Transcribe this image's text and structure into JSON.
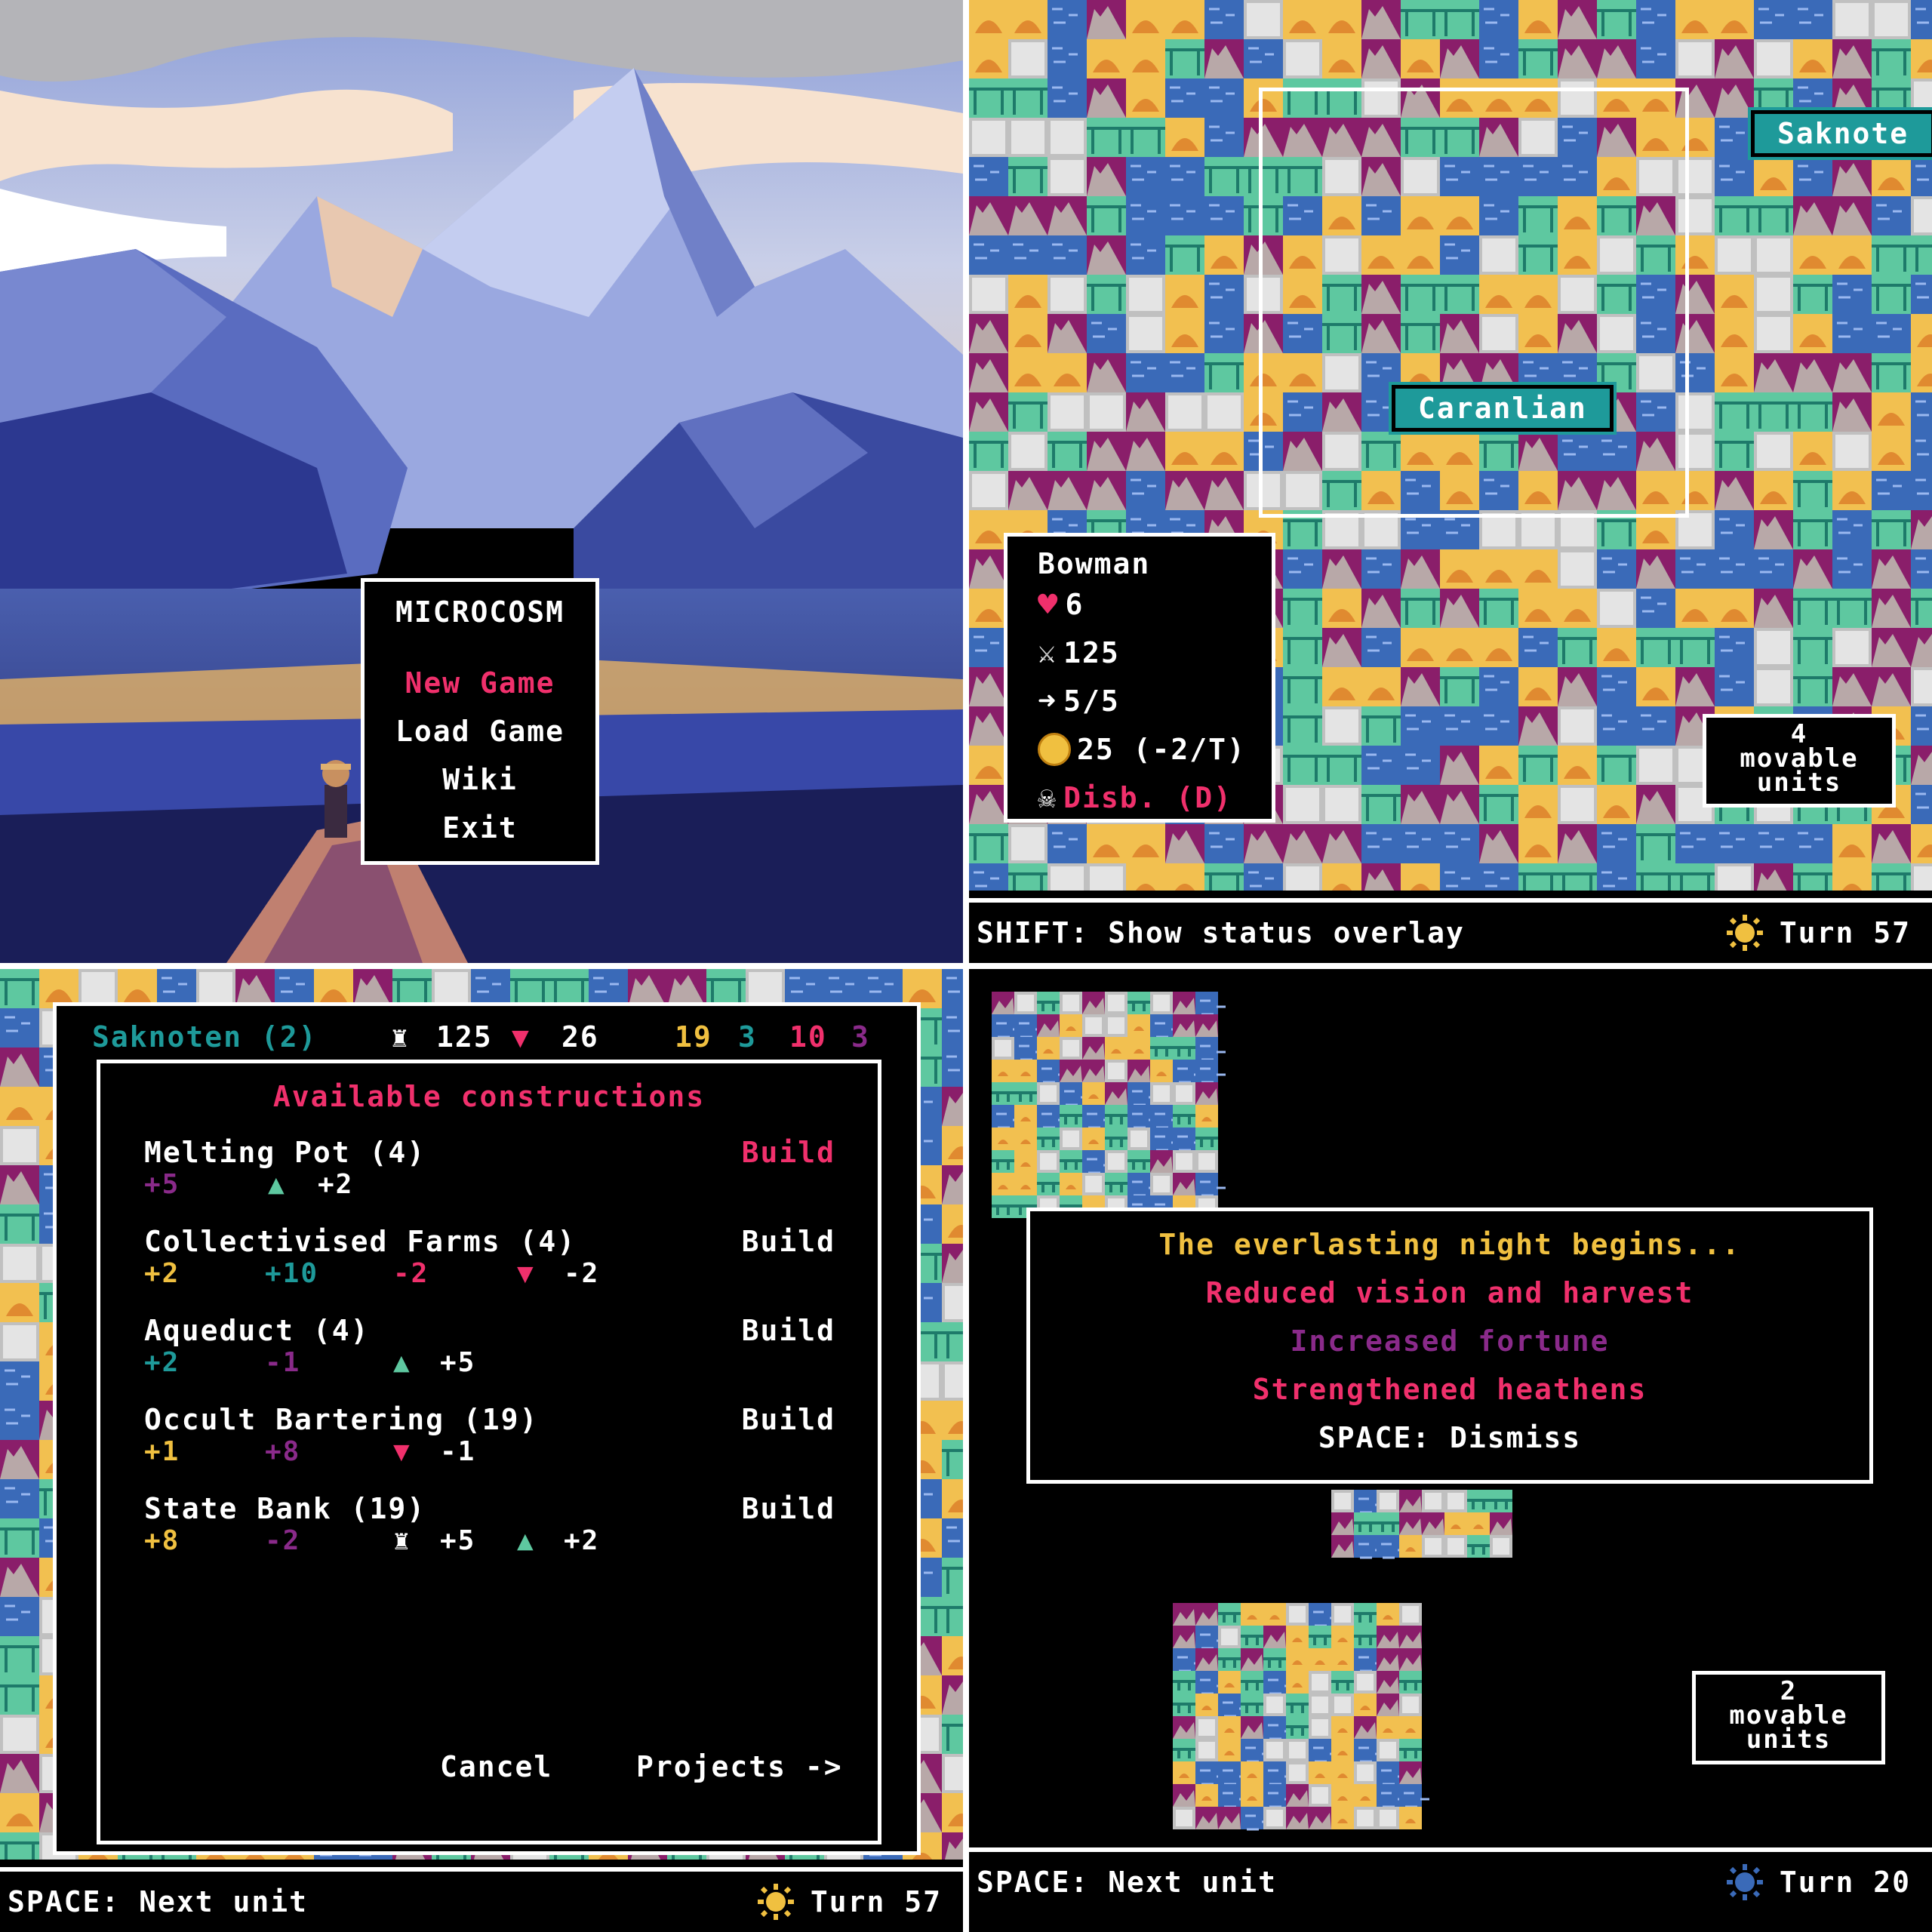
{
  "colors": {
    "accent_pink": "#f0306c",
    "purple": "#8a2a8a",
    "yellow": "#f0c040",
    "teal": "#1e9a9a",
    "tile_blue": "#3a6ab8",
    "tile_purple": "#8a1e6a",
    "tile_yellow": "#f2c050",
    "tile_teal": "#5ec8a0",
    "tile_gray": "#c0c0c0"
  },
  "title_screen": {
    "title": "MICROCOSM",
    "menu": [
      {
        "label": "New Game",
        "selected": true
      },
      {
        "label": "Load Game",
        "selected": false
      },
      {
        "label": "Wiki",
        "selected": false
      },
      {
        "label": "Exit",
        "selected": false
      }
    ]
  },
  "map_view": {
    "city_labels": [
      "Saknote",
      "Caranlian"
    ],
    "unit": {
      "name": "Bowman",
      "health": "6",
      "attack": "125",
      "moves": "5/5",
      "gold": "25 (-2/T)",
      "status": "Disb. (D)"
    },
    "movable_units": {
      "count": "4",
      "label": "movable units"
    },
    "hint": "SHIFT: Show status overlay",
    "turn_label": "Turn 57"
  },
  "constructions_view": {
    "civ_name": "Saknoten (2)",
    "stat_military": "125",
    "stat_unhappy": "26",
    "stat_a": "19",
    "stat_b": "3",
    "stat_c": "10",
    "stat_d": "3",
    "header": "Available constructions",
    "buildings": [
      {
        "name": "Melting Pot (4)",
        "action": "Build",
        "action_highlight": true,
        "effects": [
          {
            "text": "+5",
            "color": "purple"
          },
          {
            "icon": "thumbs-up",
            "text": "+2"
          }
        ]
      },
      {
        "name": "Collectivised Farms (4)",
        "action": "Build",
        "action_highlight": false,
        "effects": [
          {
            "text": "+2",
            "color": "yellow"
          },
          {
            "text": "+10",
            "color": "teal"
          },
          {
            "text": "-2",
            "color": "pink"
          },
          {
            "icon": "thumbs-down",
            "text": "-2"
          }
        ]
      },
      {
        "name": "Aqueduct (4)",
        "action": "Build",
        "action_highlight": false,
        "effects": [
          {
            "text": "+2",
            "color": "teal"
          },
          {
            "text": "-1",
            "color": "purple"
          },
          {
            "icon": "thumbs-up",
            "text": "+5"
          }
        ]
      },
      {
        "name": "Occult Bartering (19)",
        "action": "Build",
        "action_highlight": false,
        "effects": [
          {
            "text": "+1",
            "color": "yellow"
          },
          {
            "text": "+8",
            "color": "purple"
          },
          {
            "icon": "thumbs-down",
            "text": "-1"
          }
        ]
      },
      {
        "name": "State Bank (19)",
        "action": "Build",
        "action_highlight": false,
        "effects": [
          {
            "text": "+8",
            "color": "yellow"
          },
          {
            "text": "-2",
            "color": "purple"
          },
          {
            "icon": "soldier",
            "text": "+5"
          },
          {
            "icon": "thumbs-up",
            "text": "+2"
          }
        ]
      }
    ],
    "cancel_label": "Cancel",
    "projects_label": "Projects ->",
    "hint": "SPACE: Next unit",
    "turn_label": "Turn 57"
  },
  "night_view": {
    "event_title": "The everlasting night begins...",
    "effect_1": "Reduced vision and harvest",
    "effect_2": "Increased fortune",
    "effect_3": "Strengthened heathens",
    "dismiss": "SPACE: Dismiss",
    "movable_units": {
      "count": "2",
      "label": "movable units"
    },
    "hint": "SPACE: Next unit",
    "turn_label": "Turn 20"
  }
}
